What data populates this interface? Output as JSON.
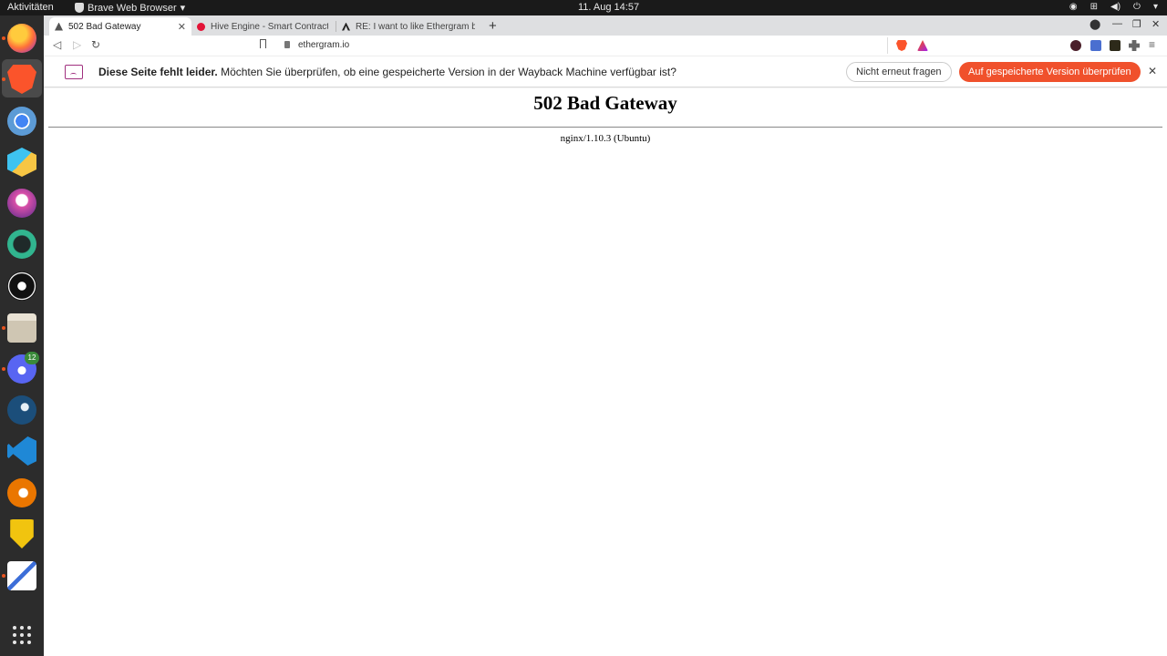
{
  "topbar": {
    "activities": "Aktivitäten",
    "app_menu": "Brave Web Browser",
    "clock": "11. Aug  14:57"
  },
  "dock": {
    "items": [
      "firefox",
      "brave",
      "chromium",
      "kotlin-ide",
      "gimp",
      "krita",
      "obs",
      "files",
      "discord",
      "steam",
      "vscode",
      "blender",
      "gitlab",
      "text-editor"
    ],
    "discord_badge": "12"
  },
  "tabs": [
    {
      "label": "502 Bad Gateway",
      "active": true
    },
    {
      "label": "Hive Engine - Smart Contract",
      "active": false
    },
    {
      "label": "RE: I want to like Ethergram b",
      "active": false
    }
  ],
  "address": {
    "url": "ethergram.io"
  },
  "infobar": {
    "bold": "Diese Seite fehlt leider.",
    "text": " Möchten Sie überprüfen, ob eine gespeicherte Version in der Wayback Machine verfügbar ist?",
    "dismiss_label": "Nicht erneut fragen",
    "action_label": "Auf gespeicherte Version überprüfen"
  },
  "page": {
    "heading": "502 Bad Gateway",
    "server": "nginx/1.10.3 (Ubuntu)"
  },
  "colors": {
    "accent": "#f0512c",
    "dock_bg": "#2c2c2c",
    "topbar_bg": "#1a1a1a"
  }
}
